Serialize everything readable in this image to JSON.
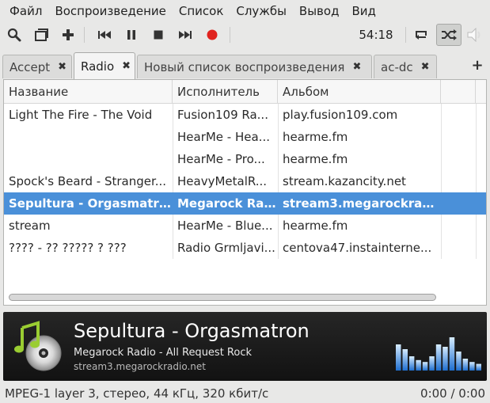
{
  "menu": [
    "Файл",
    "Воспроизведение",
    "Список",
    "Службы",
    "Вывод",
    "Вид"
  ],
  "toolbar": {
    "time": "54:18",
    "icons": [
      "search-icon",
      "stack-icon",
      "add-icon",
      "previous-icon",
      "pause-icon",
      "stop-icon",
      "next-icon",
      "record-icon",
      "repeat-icon",
      "shuffle-icon",
      "volume-icon"
    ],
    "shuffle_active": true
  },
  "tabs": [
    {
      "label": "Accept",
      "active": false
    },
    {
      "label": "Radio",
      "active": true
    },
    {
      "label": "Новый список воспроизведения",
      "active": false
    },
    {
      "label": "ac-dc",
      "active": false
    }
  ],
  "tab_close_glyph": "✖",
  "tab_add_glyph": "+",
  "playlist": {
    "columns": [
      "Название",
      "Исполнитель",
      "Альбом"
    ],
    "rows": [
      {
        "title": "Light The Fire - The Void",
        "artist": "Fusion109 Ra...",
        "album": "play.fusion109.com",
        "selected": false
      },
      {
        "title": "",
        "artist": "HearMe - Hea...",
        "album": "hearme.fm",
        "selected": false
      },
      {
        "title": "",
        "artist": "HearMe - Pro...",
        "album": "hearme.fm",
        "selected": false
      },
      {
        "title": "Spock's Beard - Stranger...",
        "artist": "HeavyMetalR...",
        "album": "stream.kazancity.net",
        "selected": false
      },
      {
        "title": "Sepultura - Orgasmatron",
        "artist": "Megarock Ra...",
        "album": "stream3.megarockradi...",
        "selected": true
      },
      {
        "title": "stream",
        "artist": "HearMe - Blue...",
        "album": "hearme.fm",
        "selected": false
      },
      {
        "title": "???? - ?? ????? ? ???",
        "artist": "Radio Grmljavi...",
        "album": "centova47.instainterne...",
        "selected": false
      }
    ]
  },
  "now_playing": {
    "title": "Sepultura - Orgasmatron",
    "station": "Megarock Radio - All Request Rock",
    "url": "stream3.megarockradio.net",
    "analyzer_levels": [
      0.55,
      0.45,
      0.3,
      0.22,
      0.18,
      0.3,
      0.55,
      0.5,
      0.7,
      0.4,
      0.25,
      0.18,
      0.14
    ],
    "colors": {
      "analyzer_top": "#d6ecff",
      "analyzer_bottom": "#1f6fd0"
    }
  },
  "status": {
    "format": "MPEG-1 layer 3, стерео, 44 кГц, 320 кбит/с",
    "position": "0:00 / 0:00"
  },
  "colors": {
    "selection": "#4a90d9",
    "record": "#e0231f"
  }
}
